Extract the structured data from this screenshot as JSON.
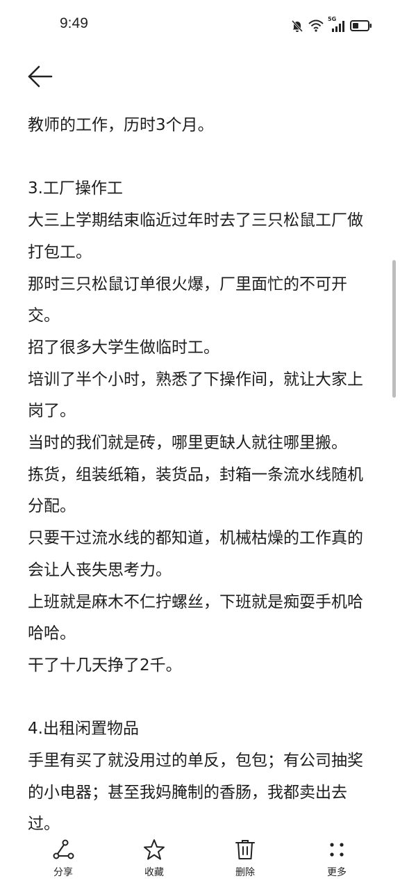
{
  "status_bar": {
    "time": "9:49",
    "icons": [
      "mute-bell-icon",
      "wifi-icon",
      "5g-signal-icon",
      "battery-icon"
    ],
    "network_label": "5G"
  },
  "toolbar": {
    "back_icon": "arrow-left-icon"
  },
  "note": {
    "paragraphs": [
      "教师的工作，历时3个月。",
      "",
      "3.工厂操作工",
      "大三上学期结束临近过年时去了三只松鼠工厂做打包工。",
      "那时三只松鼠订单很火爆，厂里面忙的不可开交。",
      "招了很多大学生做临时工。",
      "培训了半个小时，熟悉了下操作间，就让大家上岗了。",
      "当时的我们就是砖，哪里更缺人就往哪里搬。",
      "拣货，组装纸箱，装货品，封箱一条流水线随机分配。",
      "只要干过流水线的都知道，机械枯燥的工作真的会让人丧失思考力。",
      "上班就是麻木不仁拧螺丝，下班就是痴耍手机哈哈哈。",
      "干了十几天挣了2千。",
      "",
      "4.出租闲置物品",
      "手里有买了就没用过的单反，包包；有公司抽奖的小电器；甚至我妈腌制的香肠，我都卖出去过。"
    ]
  },
  "bottom_bar": {
    "share_label": "分享",
    "favorite_label": "收藏",
    "delete_label": "删除",
    "more_label": "更多"
  }
}
